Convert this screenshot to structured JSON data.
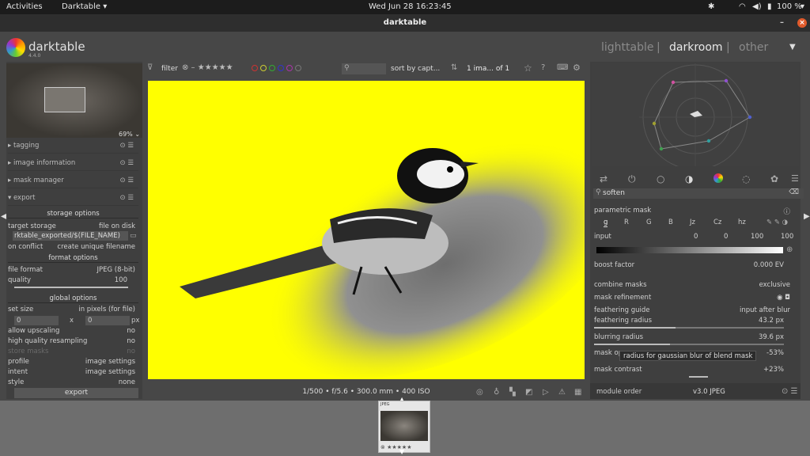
{
  "topbar": {
    "activities": "Activities",
    "app_menu": "Darktable ▾",
    "clock": "Wed Jun 28  16:23:45",
    "battery": "100 %"
  },
  "window": {
    "title": "darktable"
  },
  "app": {
    "name": "darktable",
    "version": "4.4.0"
  },
  "views": {
    "lighttable": "lighttable",
    "sep1": "|",
    "darkroom": "darkroom",
    "sep2": "|",
    "other": "other"
  },
  "left": {
    "zoom": "69% ⌄",
    "modules": [
      {
        "label": "tagging"
      },
      {
        "label": "image information"
      },
      {
        "label": "mask manager"
      },
      {
        "label": "export"
      }
    ],
    "storage_options": "storage options",
    "target_storage_label": "target storage",
    "target_storage_value": "file on disk",
    "path": "rktable_exported/$(FILE_NAME)",
    "on_conflict_label": "on conflict",
    "on_conflict_value": "create unique filename",
    "format_options": "format options",
    "file_format_label": "file format",
    "file_format_value": "JPEG (8-bit)",
    "quality_label": "quality",
    "quality_value": "100",
    "global_options": "global options",
    "set_size_label": "set size",
    "set_size_value": "in pixels (for file)",
    "width": "0",
    "x": "x",
    "height": "0",
    "px": "px",
    "allow_upscaling_label": "allow upscaling",
    "allow_upscaling_value": "no",
    "hq_label": "high quality resampling",
    "hq_value": "no",
    "store_masks_label": "store masks",
    "store_masks_value": "no",
    "profile_label": "profile",
    "profile_value": "image settings",
    "intent_label": "intent",
    "intent_value": "image settings",
    "style_label": "style",
    "style_value": "none",
    "export_button": "export"
  },
  "filterbar": {
    "filter": "filter",
    "sort_by": "sort by",
    "sort_value": "capt...",
    "count": "1 ima... of 1"
  },
  "status": {
    "exif": "1/500 • f/5.6 • 300.0 mm • 400 ISO"
  },
  "right": {
    "search": "soften",
    "parametric_mask": "parametric mask",
    "channels": [
      "g",
      "R",
      "G",
      "B",
      "Jz",
      "Cz",
      "hz"
    ],
    "input_label": "input",
    "input_values": [
      "0",
      "0",
      "100",
      "100"
    ],
    "boost_label": "boost factor",
    "boost_value": "0.000 EV",
    "combine_label": "combine masks",
    "combine_value": "exclusive",
    "refinement_label": "mask refinement",
    "feather_guide_label": "feathering guide",
    "feather_guide_value": "input after blur",
    "feather_radius_label": "feathering radius",
    "feather_radius_value": "43.2 px",
    "blur_radius_label": "blurring radius",
    "blur_radius_value": "39.6 px",
    "mask_op_label": "mask op",
    "mask_op_value": "-53%",
    "tooltip": "radius for gaussian blur of blend mask",
    "contrast_label": "mask contrast",
    "contrast_value": "+23%",
    "module_order_label": "module order",
    "module_order_value": "v3.0 JPEG"
  },
  "filmstrip": {
    "thumb_label": "JPEG"
  },
  "colors": {
    "accent_yellow": "#ffff00",
    "panel": "#3f3f3f",
    "background": "#474747"
  },
  "progress": {
    "feathering_radius": 0.43,
    "blurring_radius": 0.4,
    "quality": 1.0,
    "mask_contrast": 0.6
  }
}
